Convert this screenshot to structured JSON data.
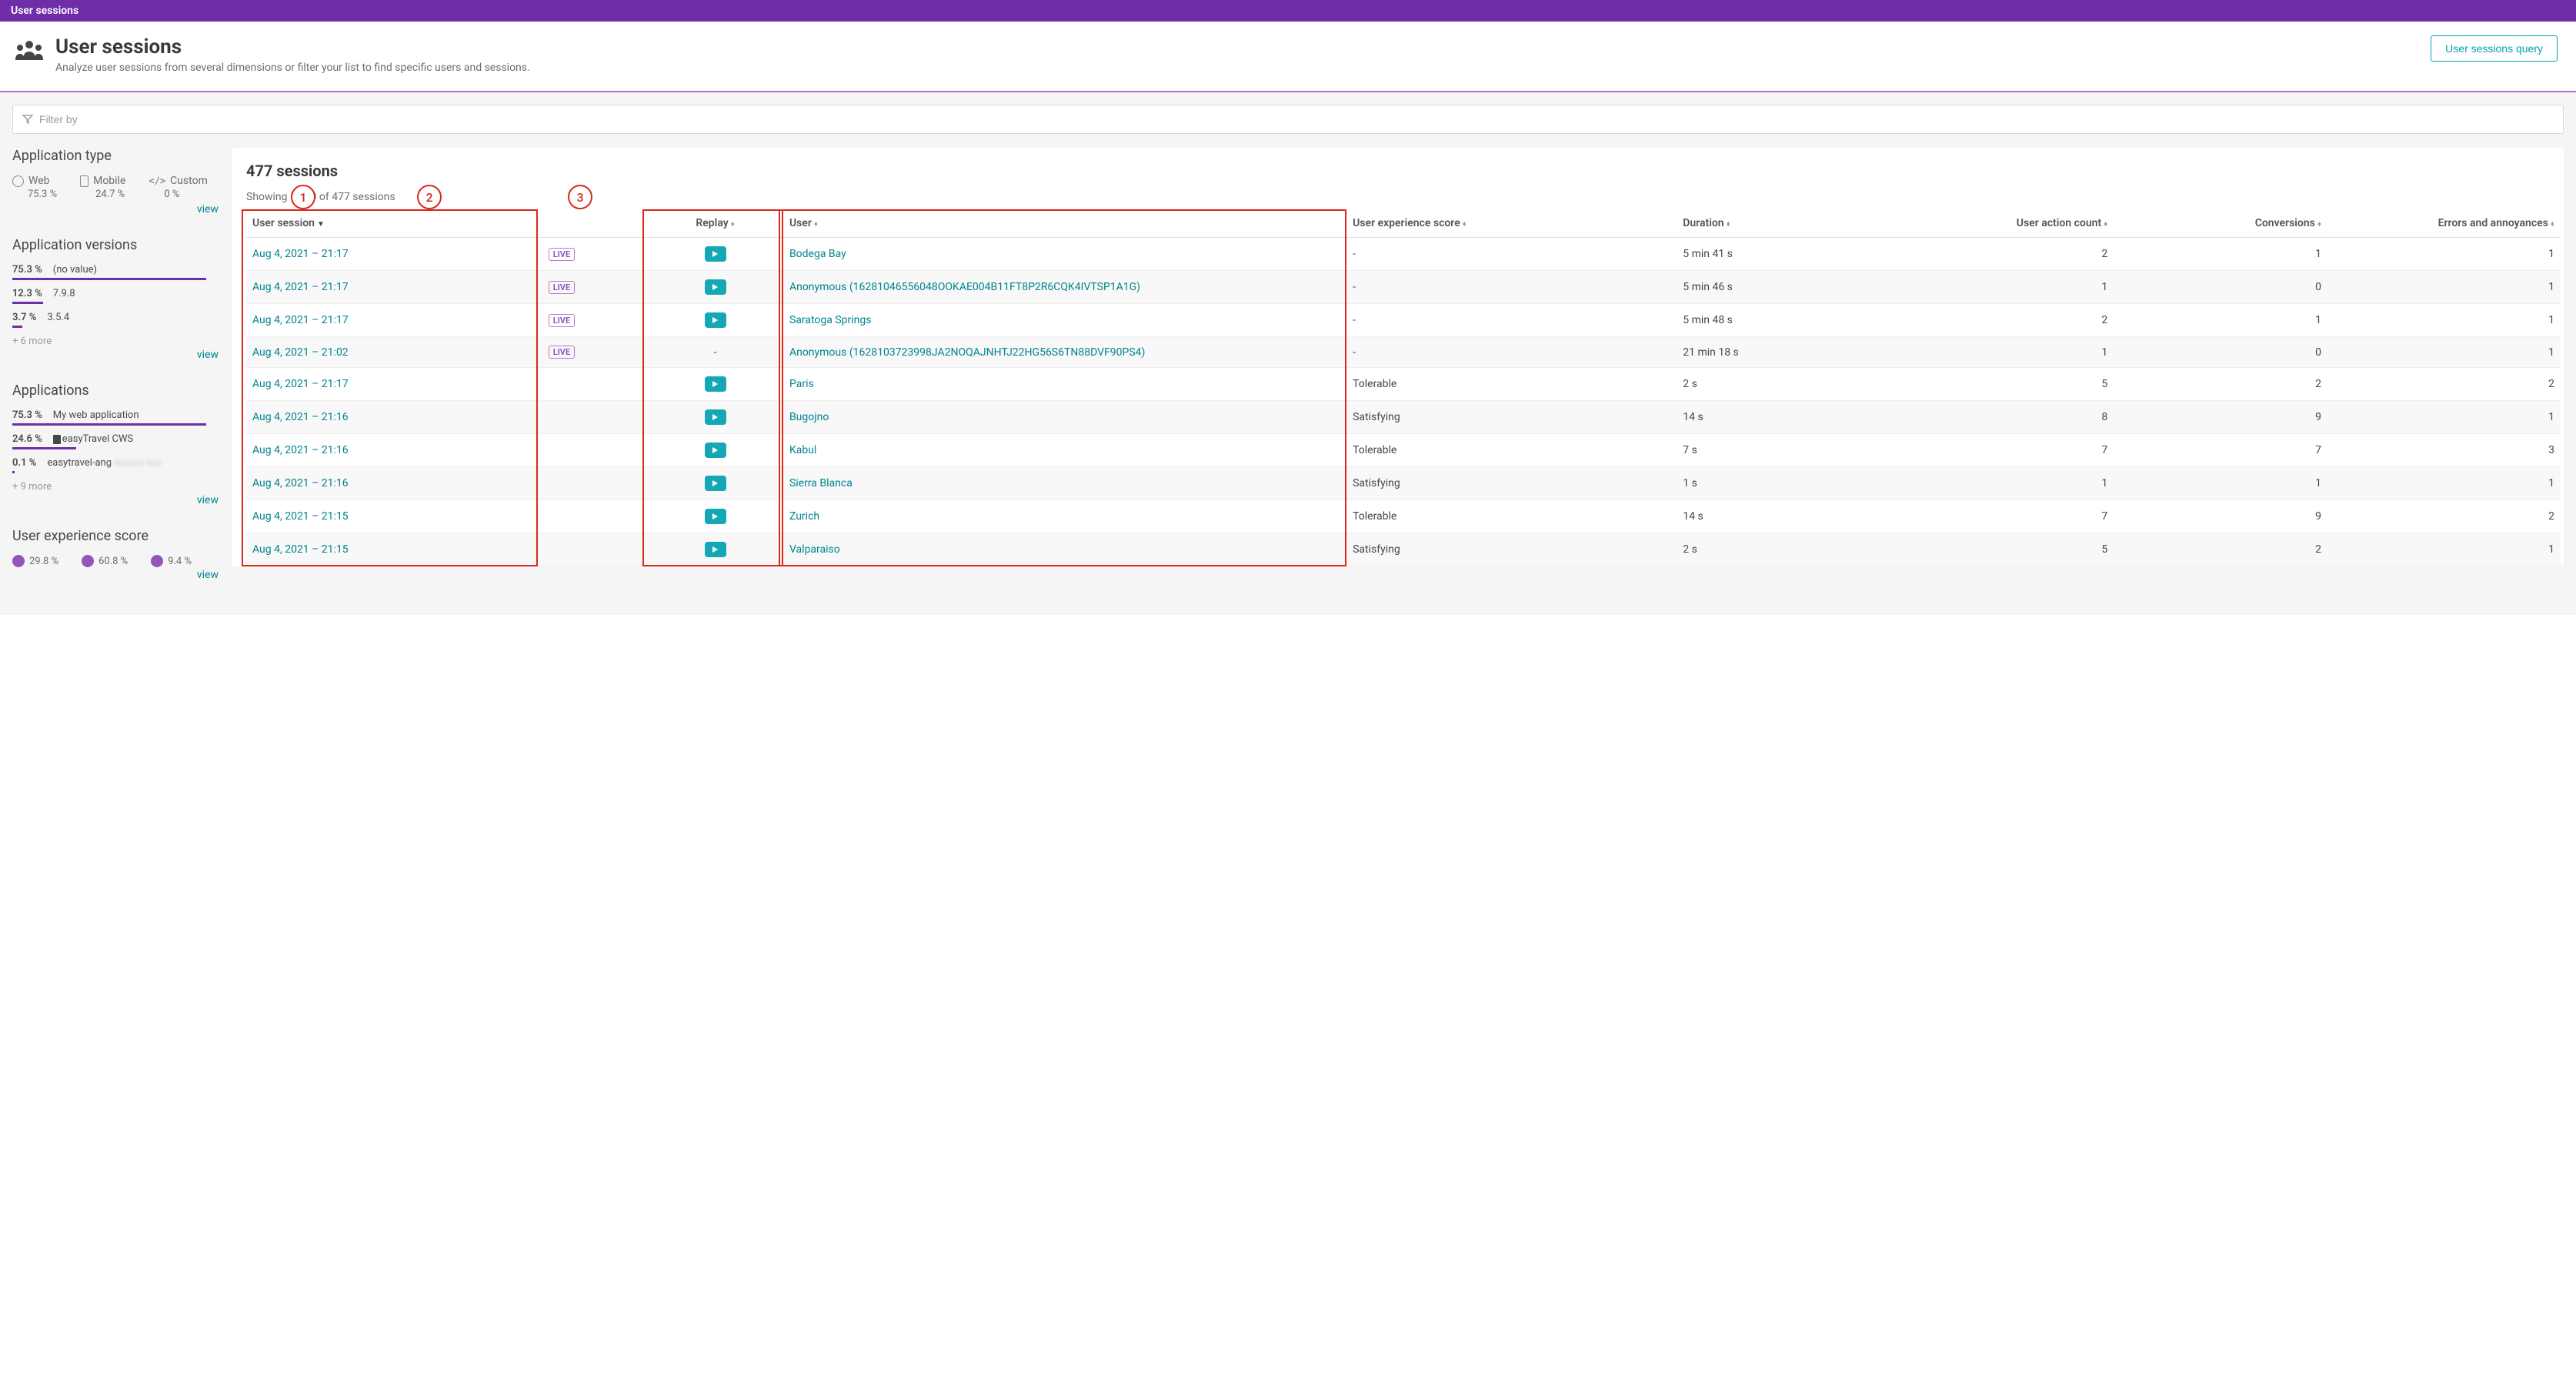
{
  "topbar": {
    "title": "User sessions"
  },
  "header": {
    "title": "User sessions",
    "subtitle": "Analyze user sessions from several dimensions or filter your list to find specific users and sessions.",
    "query_button": "User sessions query"
  },
  "filter": {
    "placeholder": "Filter by"
  },
  "facets": {
    "app_type": {
      "title": "Application type",
      "items": [
        {
          "label": "Web",
          "pct": "75.3 %",
          "icon": "globe"
        },
        {
          "label": "Mobile",
          "pct": "24.7 %",
          "icon": "mobile"
        },
        {
          "label": "Custom",
          "pct": "0 %",
          "icon": "code"
        }
      ],
      "view": "view"
    },
    "versions": {
      "title": "Application versions",
      "items": [
        {
          "pct": "75.3 %",
          "label": "(no value)",
          "bar": 100
        },
        {
          "pct": "12.3 %",
          "label": "7.9.8",
          "bar": 16
        },
        {
          "pct": "3.7 %",
          "label": "3.5.4",
          "bar": 5
        }
      ],
      "more": "+ 6 more",
      "view": "view"
    },
    "applications": {
      "title": "Applications",
      "items": [
        {
          "pct": "75.3 %",
          "label": "My web application",
          "bar": 100,
          "icon": false
        },
        {
          "pct": "24.6 %",
          "label": "easyTravel CWS",
          "bar": 33,
          "icon": true
        },
        {
          "pct": "0.1 %",
          "label": "easytravel-ang",
          "bar": 1,
          "icon": false,
          "blurred": true
        }
      ],
      "more": "+ 9 more",
      "view": "view"
    },
    "ux": {
      "title": "User experience score",
      "items": [
        {
          "pct": "29.8 %",
          "color": "purple"
        },
        {
          "pct": "60.8 %",
          "color": "purple"
        },
        {
          "pct": "9.4 %",
          "color": "purple"
        }
      ],
      "view": "view"
    }
  },
  "main": {
    "title": "477 sessions",
    "showing": "Showing 1 - 50 of 477 sessions",
    "columns": {
      "session": "User session",
      "replay": "Replay",
      "user": "User",
      "ux": "User experience score",
      "duration": "Duration",
      "uac": "User action count",
      "conversions": "Conversions",
      "errors": "Errors and annoyances"
    },
    "rows": [
      {
        "ts": "Aug 4, 2021  –  21:17",
        "live": true,
        "replay": true,
        "user": "Bodega Bay",
        "ux": "-",
        "duration": "5 min 41 s",
        "uac": "2",
        "conv": "1",
        "err": "1"
      },
      {
        "ts": "Aug 4, 2021  –  21:17",
        "live": true,
        "replay": true,
        "user": "Anonymous (16281046556048OOKAE004B11FT8P2R6CQK4IVTSP1A1G)",
        "ux": "-",
        "duration": "5 min 46 s",
        "uac": "1",
        "conv": "0",
        "err": "1"
      },
      {
        "ts": "Aug 4, 2021  –  21:17",
        "live": true,
        "replay": true,
        "user": "Saratoga Springs",
        "ux": "-",
        "duration": "5 min 48 s",
        "uac": "2",
        "conv": "1",
        "err": "1"
      },
      {
        "ts": "Aug 4, 2021  –  21:02",
        "live": true,
        "replay": false,
        "user": "Anonymous (1628103723998JA2NOQAJNHTJ22HG56S6TN88DVF90PS4)",
        "ux": "-",
        "duration": "21 min 18 s",
        "uac": "1",
        "conv": "0",
        "err": "1"
      },
      {
        "ts": "Aug 4, 2021  –  21:17",
        "live": false,
        "replay": true,
        "user": "Paris",
        "ux": "Tolerable",
        "duration": "2 s",
        "uac": "5",
        "conv": "2",
        "err": "2"
      },
      {
        "ts": "Aug 4, 2021  –  21:16",
        "live": false,
        "replay": true,
        "user": "Bugojno",
        "ux": "Satisfying",
        "duration": "14 s",
        "uac": "8",
        "conv": "9",
        "err": "1"
      },
      {
        "ts": "Aug 4, 2021  –  21:16",
        "live": false,
        "replay": true,
        "user": "Kabul",
        "ux": "Tolerable",
        "duration": "7 s",
        "uac": "7",
        "conv": "7",
        "err": "3"
      },
      {
        "ts": "Aug 4, 2021  –  21:16",
        "live": false,
        "replay": true,
        "user": "Sierra Blanca",
        "ux": "Satisfying",
        "duration": "1 s",
        "uac": "1",
        "conv": "1",
        "err": "1"
      },
      {
        "ts": "Aug 4, 2021  –  21:15",
        "live": false,
        "replay": true,
        "user": "Zurich",
        "ux": "Tolerable",
        "duration": "14 s",
        "uac": "7",
        "conv": "9",
        "err": "2"
      },
      {
        "ts": "Aug 4, 2021  –  21:15",
        "live": false,
        "replay": true,
        "user": "Valparaiso",
        "ux": "Satisfying",
        "duration": "2 s",
        "uac": "5",
        "conv": "2",
        "err": "1"
      }
    ]
  },
  "badges": {
    "live": "LIVE"
  },
  "annotations": {
    "a1": "1",
    "a2": "2",
    "a3": "3"
  }
}
